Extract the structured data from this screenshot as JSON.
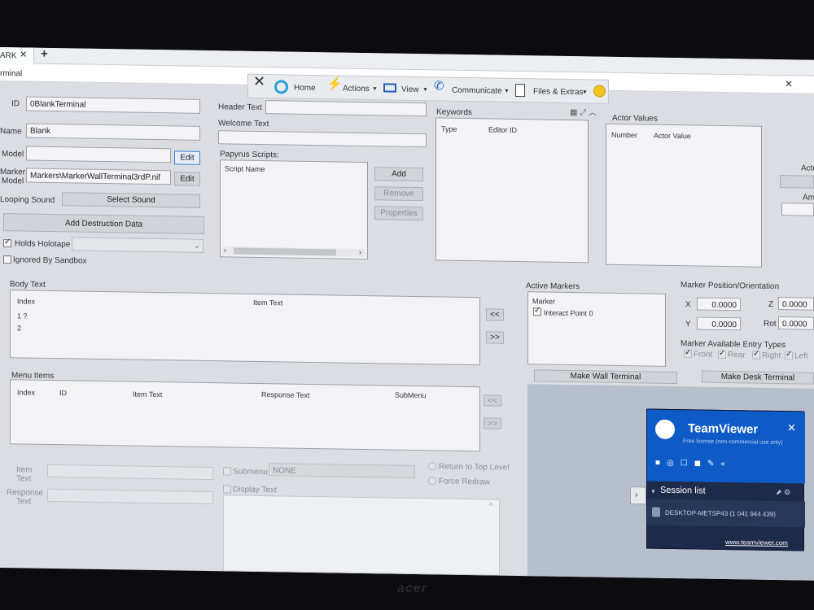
{
  "browser": {
    "tab_label": "ARK",
    "tab_close": "✕",
    "new_tab": "+"
  },
  "window": {
    "title": "rminal",
    "close": "✕"
  },
  "teamviewer_bar": {
    "home": "Home",
    "actions": "Actions",
    "view": "View",
    "communicate": "Communicate",
    "files": "Files & Extras"
  },
  "form": {
    "id_label": "ID",
    "id_value": "0BlankTerminal",
    "name_label": "Name",
    "name_value": "Blank",
    "model_label": "Model",
    "model_value": "",
    "edit": "Edit",
    "marker_model_label_1": "Marker",
    "marker_model_label_2": "Model",
    "marker_model_value": "Markers\\MarkerWallTerminal3rdP.nif",
    "looping_sound_label": "Looping Sound",
    "select_sound": "Select Sound",
    "add_destruction": "Add Destruction Data",
    "holds_holotape": "Holds Holotape",
    "ignored_by_sandbox": "Ignored By Sandbox",
    "header_text_label": "Header Text",
    "welcome_text_label": "Welcome Text",
    "papyrus_label": "Papyrus Scripts:",
    "script_name_col": "Script Name",
    "add": "Add",
    "remove": "Remove",
    "properties": "Properties"
  },
  "keywords": {
    "label": "Keywords",
    "col_type": "Type",
    "col_editor_id": "Editor ID"
  },
  "actor_values": {
    "label": "Actor Values",
    "col_number": "Number",
    "col_actor_value": "Actor Value",
    "side_1": "Acto",
    "side_2": "Am"
  },
  "body_text": {
    "label": "Body Text",
    "col_index": "Index",
    "col_item_text": "Item Text",
    "rows": [
      "1 ?",
      "2"
    ],
    "btn_left": "<<",
    "btn_right": ">>"
  },
  "menu_items": {
    "label": "Menu Items",
    "col_index": "Index",
    "col_id": "ID",
    "col_item_text": "Item Text",
    "col_response_text": "Response Text",
    "col_submenu": "SubMenu",
    "btn_left": "<<",
    "btn_right": ">>"
  },
  "detail": {
    "item_text_1": "Item",
    "item_text_2": "Text",
    "response_text_1": "Response",
    "response_text_2": "Text",
    "submenu": "Submenu",
    "submenu_value": "NONE",
    "return_to_top": "Return to Top Level",
    "force_redraw": "Force Redraw",
    "display_text": "Display Text"
  },
  "active_markers": {
    "label": "Active Markers",
    "col_marker": "Marker",
    "rows": [
      "Interact Point 0"
    ]
  },
  "marker_pos": {
    "label": "Marker Position/Orientation",
    "x_label": "X",
    "x_value": "0.0000",
    "y_label": "Y",
    "y_value": "0.0000",
    "z_label": "Z",
    "z_value": "0.0000",
    "rot_label": "Rot",
    "rot_value": "0.0000"
  },
  "entry_types": {
    "label": "Marker Available Entry Types",
    "front": "Front",
    "rear": "Rear",
    "right": "Right",
    "left": "Left"
  },
  "make_wall": "Make Wall Terminal",
  "make_desk": "Make Desk Terminal",
  "teamviewer_panel": {
    "brand": "TeamViewer",
    "license": "Free license (non-commercial use only)",
    "close": "✕",
    "session_list": "Session list",
    "session_item": "DESKTOP-METSP43 (1 041 944 439)",
    "link": "www.teamviewer.com"
  },
  "bezel_logo": "acer",
  "colors": {
    "tv_blue": "#0e5bc7",
    "tv_dark": "#1d2b4a",
    "screen_bg": "#dcdde3"
  }
}
